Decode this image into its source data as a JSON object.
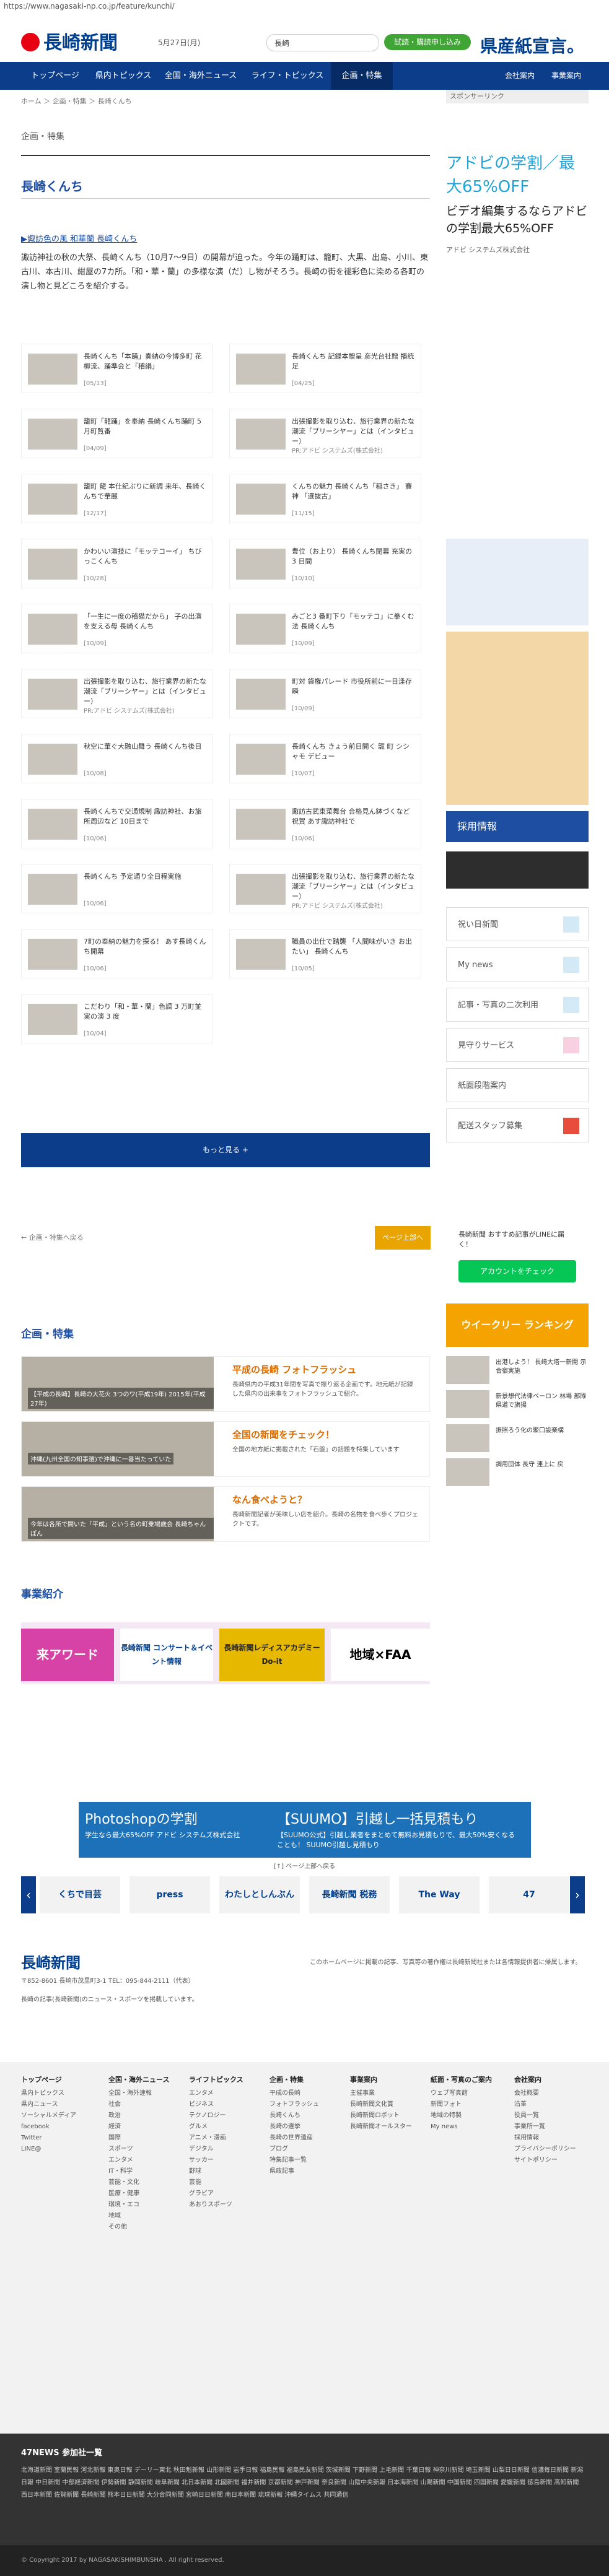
{
  "browser": {
    "url": "https://www.nagasaki-np.co.jp/feature/kunchi/"
  },
  "header": {
    "logo": "長崎新聞",
    "date": "5月27日(月)",
    "search_placeholder": "",
    "search_label": "長崎",
    "subscribe": "試読・購読申し込み",
    "ad_text": "県産紙宣言。"
  },
  "nav": {
    "items": [
      "トップページ",
      "県内トピックス",
      "全国・海外ニュース",
      "ライフ・トピックス",
      "企画・特集"
    ],
    "right": [
      "会社案内",
      "事業案内"
    ]
  },
  "breadcrumb": "ホーム ＞ 企画・特集 ＞ 長崎くんち",
  "sponsor_label": "スポンサーリンク",
  "section_label": "企画・特集",
  "page_title": "長崎くんち",
  "intro": {
    "link": "▶諏訪色の風 和華蘭 長崎くんち",
    "text": "諏訪神社の秋の大祭、長崎くんち（10月7〜9日）の開幕が迫った。今年の踊町は、籠町、大黒、出島、小川、東古川、本古川、紺屋の7カ所。「和・華・蘭」の多様な演（だ）し物がそろう。長崎の街を褪彩色に染める各町の演し物と見どころを紹介する。"
  },
  "articles": [
    {
      "title": "長崎くんち「本踊」奏納の今博多町 花柳流、踊準会と「稽絹」",
      "date": "[05/13]"
    },
    {
      "title": "長崎くんち 記録本贈呈 彦光台社贈 播統足",
      "date": "[04/25]"
    },
    {
      "title": "籠町「龍踊」を奉納 長崎くんち踊町 5月町覧番",
      "date": "[04/09]"
    },
    {
      "title": "出張撮影を取り込む、旅行業界の新たな潮流「ブリーシヤー」とは（インタビュー）",
      "date": "PR:アドビ システムズ(株式会社)"
    },
    {
      "title": "籠町 龍 本仕紀ぶりに新調 来年、長崎くんちで華麗",
      "date": "[12/17]"
    },
    {
      "title": "くんちの魅力 長崎くんち「稲さき」 賽神 「選抜古」",
      "date": "[11/15]"
    },
    {
      "title": "かわいい演技に「モッテコーイ」 ちびっこくんち",
      "date": "[10/28]"
    },
    {
      "title": "豊位（お上り） 長崎くんち閉幕 充実の 3 日間",
      "date": "[10/10]"
    },
    {
      "title": "「一生に一度の稽猫だから」 子の出演を支える母 長崎くんち",
      "date": "[10/09]"
    },
    {
      "title": "みごと3 番町下り「モッテコ」に拳くむ法 長崎くんち",
      "date": "[10/09]"
    },
    {
      "title": "出張撮影を取り込む、旅行業界の新たな潮流「ブリーシヤー」とは（インタビュー）",
      "date": "PR:アドビ システムズ(株式会社)"
    },
    {
      "title": "町対 袋権パレード 市役所前に一日逢存瞬",
      "date": "[10/09]"
    },
    {
      "title": "秋空に華ぐ大融山舞う 長崎くんち後日",
      "date": "[10/08]"
    },
    {
      "title": "長崎くんち きょう前日開く 籠 町 シシャモ デビュー",
      "date": "[10/07]"
    },
    {
      "title": "長崎くんちで交通規制 諏訪神社、お旅所周辺など 10日まで",
      "date": "[10/06]"
    },
    {
      "title": "諏訪古武東菜舞台 合格見ん鉢づくなど祝賀 あす諏訪神社で",
      "date": "[10/06]"
    },
    {
      "title": "長崎くんち 予定通り全日程実施",
      "date": "[10/06]"
    },
    {
      "title": "出張撮影を取り込む、旅行業界の新たな潮流「ブリーシヤー」とは（インタビュー）",
      "date": "PR:アドビ システムズ(株式会社)"
    },
    {
      "title": "7町の奉納の魅力を探る！ あす長崎くんち開幕",
      "date": "[10/06]"
    },
    {
      "title": "職員の出仕で踏襲 「人間味がいき お出たい」 長崎くんち",
      "date": "[10/05]"
    },
    {
      "title": "こだわり「和・華・蘭」色調 3 万町並実の演 3 度",
      "date": "[10/04]"
    }
  ],
  "more_button": "もっと見る +",
  "pager": {
    "prev": "← 企画・特集へ戻る",
    "next": "ページ上部へ"
  },
  "features": {
    "heading": "企画・特集",
    "items": [
      {
        "title": "平成の長崎 フォトフラッシュ",
        "desc": "長崎県内の平成31年間を写真で振り返る企画です。地元紙が記録した県内の出来事をフォトフラッシュで紹介。",
        "caption": "【平成の長崎】長崎の大花火 3つのワ(平成19年) 2015年(平成27年)"
      },
      {
        "title": "全国の新聞をチェック！",
        "desc": "全国の地方紙に掲載された「石盤」の話題を特集しています",
        "caption": "沖縄(九州全国の知事選)で沖縄に一番当たっていた"
      },
      {
        "title": "なん食べようと？",
        "desc": "長崎新聞記者が美味しい店を紹介。長崎の名物を食べ歩くプロジェクトです。",
        "caption": "今年は各所で開いた「平成」という名の町乗場歳会 長崎ちゃんぽん"
      }
    ]
  },
  "business": {
    "heading": "事業紹介",
    "items": [
      "来アワード",
      "長崎新聞 コンサート＆イベント情報",
      "長崎新聞レディスアカデミー Do-it",
      "地域×FAA"
    ]
  },
  "sidebar": {
    "ad": {
      "l1": "アドビの学割／最大65%OFF",
      "l2": "ビデオ編集するならアドビの学割最大65%OFF",
      "l3": "アドビ システムズ株式会社"
    },
    "recruit": "採用情報",
    "buttons": [
      "祝い日新聞",
      "My news",
      "記事・写真の二次利用",
      "見守りサービス",
      "紙面段階案内",
      "配送スタッフ募集"
    ],
    "line": "アカウントをチェック",
    "line_caption": "長崎新聞 おすすめ記事がLINEに届く！",
    "ranking_title": "ウイークリー ランキング",
    "news": [
      "出港しよう！ 長崎大塔一新開 示合宿実施",
      "新景想代法律ペーロン 林場 部隊 県道で旗揚",
      "振照ろう化の聚口設楽構",
      "調用団体 長守 連上に 戻"
    ]
  },
  "bottom_ad": {
    "left": "Photoshopの学割",
    "left_sub": "学生なら最大65%OFF アドビ システムズ株式会社",
    "right": "【SUUMO】引越し一括見積もり",
    "right_sub": "【SUUMO公式】引越し業者をまとめて無料お見積もりで、最大50%安くなることも！ SUUMO引越し見積もり"
  },
  "carousel": [
    "くちで目芸",
    "press",
    "わたしとしんぶん",
    "長崎新聞 税務",
    "The Way",
    "47"
  ],
  "pagetop": "[↑] ページ上部へ戻る",
  "footer": {
    "address": "〒852-8601 長崎市茂里町3-1 TEL：095-844-2111（代表）",
    "tagline": "長崎の記事(長崎新聞)のニュース・スポーツを掲載しています。",
    "notice": "このホームページに掲載の記事、写真等の著作権は長崎新聞社または各情報提供者に帰属します。",
    "cols": [
      {
        "h": "トップページ",
        "items": [
          "県内トピックス",
          "県内ニュース",
          "ソーシャルメディア",
          "facebook",
          "Twitter",
          "LINE@"
        ]
      },
      {
        "h": "全国・海外ニュース",
        "items": [
          "全国・海外速報",
          "社会",
          "政治",
          "経済",
          "国際",
          "スポーツ",
          "エンタメ",
          "IT・科学",
          "芸能・文化",
          "医療・健康",
          "環境・エコ",
          "地域",
          "その他"
        ]
      },
      {
        "h": "ライフトピックス",
        "items": [
          "エンタメ",
          "ビジネス",
          "テクノロジー",
          "グルメ",
          "アニメ・漫画",
          "デジタル",
          "サッカー",
          "野球",
          "芸能",
          "グラビア",
          "あおりスポーツ"
        ]
      },
      {
        "h": "企画・特集",
        "items": [
          "平成の長崎",
          "フォトフラッシュ",
          "長崎くんち",
          "長崎の選挙",
          "長崎の世界遺産",
          "ブログ",
          "特集記事一覧",
          "県政記事"
        ]
      },
      {
        "h": "事業案内",
        "items": [
          "主催事業",
          "長崎新聞文化賞",
          "長崎新聞ロボット",
          "長崎新聞オールスター"
        ]
      },
      {
        "h": "紙面・写真のご案内",
        "items": [
          "ウェブ写真館",
          "新聞フォト",
          "地域の特製",
          "My news"
        ]
      },
      {
        "h": "会社案内",
        "items": [
          "会社概要",
          "沿革",
          "役員一覧",
          "事業所一覧",
          "採用情報",
          "プライバシーポリシー",
          "サイトポリシー"
        ]
      }
    ]
  },
  "news47": {
    "heading": "47NEWS 参加社一覧",
    "list": "北海道新聞 室蘭民報 河北新報 東奥日報 デーリー東北 秋田魁新報 山形新聞 岩手日報 福島民報 福島民友新聞 茨城新聞 下野新聞 上毛新聞 千葉日報 神奈川新聞 埼玉新聞 山梨日日新聞 信濃毎日新聞 新潟日報 中日新聞 中部経済新聞 伊勢新聞 静岡新聞 岐阜新聞 北日本新聞 北國新聞 福井新聞 京都新聞 神戸新聞 奈良新聞 山陰中央新報 日本海新聞 山陽新聞 中国新聞 四国新聞 愛媛新聞 徳島新聞 高知新聞 西日本新聞 佐賀新聞 長崎新聞 熊本日日新聞 大分合同新聞 宮崎日日新聞 南日本新聞 琉球新報 沖縄タイムス 共同通信"
  },
  "copyright": "© Copyright 2017 by NAGASAKISHIMBUNSHA . All right reserved."
}
